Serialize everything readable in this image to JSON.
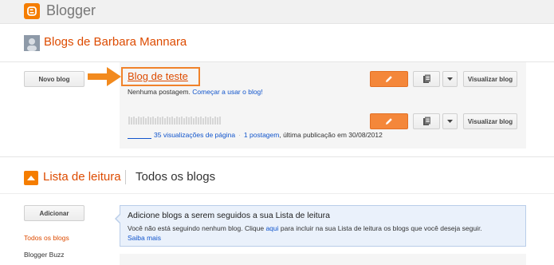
{
  "app": {
    "brand": "Blogger",
    "accent": "#f57d00"
  },
  "blogs_header": {
    "title": "Blogs de Barbara Mannara"
  },
  "toolbar": {
    "new_blog_label": "Novo blog"
  },
  "blogs": [
    {
      "name": "Blog de teste",
      "status_text": "Nenhuma postagem.",
      "status_link": "Começar a usar o blog!",
      "view_label": "Visualizar blog"
    },
    {
      "name": "",
      "pageviews": "35 visualizações de página",
      "posts": "1 postagem",
      "last_published": ", última publicação em 30/08/2012",
      "view_label": "Visualizar blog"
    }
  ],
  "reading_list": {
    "title": "Lista de leitura",
    "subtitle": "Todos os blogs",
    "add_label": "Adicionar",
    "nav": [
      "Todos os blogs",
      "Blogger Buzz"
    ],
    "info_title": "Adicione blogs a serem seguidos a sua Lista de leitura",
    "info_text_pre": "Você não está seguindo nenhum blog. Clique ",
    "info_link_here": "aqui",
    "info_text_post": " para incluir na sua Lista de leitura os blogs que você deseja seguir.",
    "info_link_more": "Saiba mais"
  }
}
